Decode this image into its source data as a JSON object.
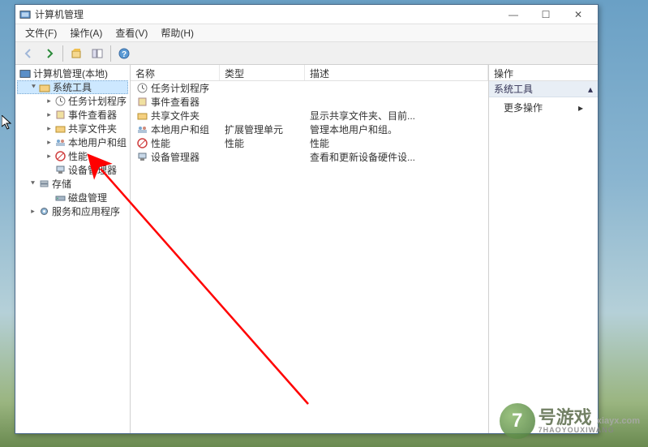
{
  "window": {
    "title": "计算机管理"
  },
  "menu": {
    "file": "文件(F)",
    "action": "操作(A)",
    "view": "查看(V)",
    "help": "帮助(H)"
  },
  "tree": {
    "root": "计算机管理(本地)",
    "system_tools": "系统工具",
    "task_scheduler": "任务计划程序",
    "event_viewer": "事件查看器",
    "shared_folders": "共享文件夹",
    "local_users": "本地用户和组",
    "performance": "性能",
    "device_manager": "设备管理器",
    "storage": "存储",
    "disk_management": "磁盘管理",
    "services": "服务和应用程序"
  },
  "list": {
    "columns": {
      "name": "名称",
      "type": "类型",
      "desc": "描述"
    },
    "rows": [
      {
        "name": "任务计划程序",
        "type": "",
        "desc": ""
      },
      {
        "name": "事件查看器",
        "type": "",
        "desc": ""
      },
      {
        "name": "共享文件夹",
        "type": "",
        "desc": "显示共享文件夹、目前..."
      },
      {
        "name": "本地用户和组",
        "type": "扩展管理单元",
        "desc": "管理本地用户和组。"
      },
      {
        "name": "性能",
        "type": "性能",
        "desc": "性能"
      },
      {
        "name": "设备管理器",
        "type": "",
        "desc": "查看和更新设备硬件设..."
      }
    ]
  },
  "actions": {
    "header": "操作",
    "group": "系统工具",
    "more": "更多操作"
  },
  "watermark": {
    "main": "号游戏",
    "url": "xiayx.com",
    "pinyin": "7HAOYOUXIWANG"
  }
}
